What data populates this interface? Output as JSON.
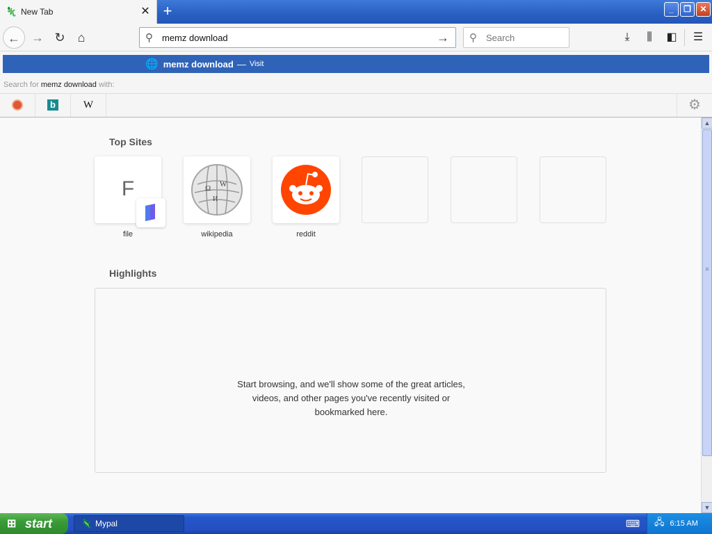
{
  "tab": {
    "title": "New Tab",
    "close_icon": "close-icon",
    "new_tab_icon": "plus-icon"
  },
  "window_controls": [
    "minimize",
    "restore",
    "close"
  ],
  "navbar": {
    "url_value": "memz download",
    "search_placeholder": "Search"
  },
  "popup": {
    "selected": {
      "title": "memz download",
      "dash": "—",
      "action": "Visit"
    },
    "search_for_prefix": "Search for ",
    "search_for_query": "memz download",
    "search_for_suffix": " with:",
    "engines": [
      "DuckDuckGo",
      "Bing",
      "Wikipedia"
    ],
    "wiki_glyph": "W"
  },
  "content": {
    "top_sites_title": "Top Sites",
    "top_sites": [
      {
        "label": "file",
        "letter": "F"
      },
      {
        "label": "wikipedia"
      },
      {
        "label": "reddit"
      },
      {
        "label": ""
      },
      {
        "label": ""
      },
      {
        "label": ""
      }
    ],
    "highlights_title": "Highlights",
    "highlights_empty_line1": "Start browsing, and we'll show some of the great articles,",
    "highlights_empty_line2": "videos, and other pages you've recently visited or",
    "highlights_empty_line3": "bookmarked here."
  },
  "taskbar": {
    "start_label": "start",
    "task_label": "Mypal",
    "clock": "6:15 AM"
  },
  "colors": {
    "selected_row": "#2f63b8",
    "reddit": "#ff4500",
    "taskbar": "#2456c8",
    "start": "#3a9b37"
  }
}
